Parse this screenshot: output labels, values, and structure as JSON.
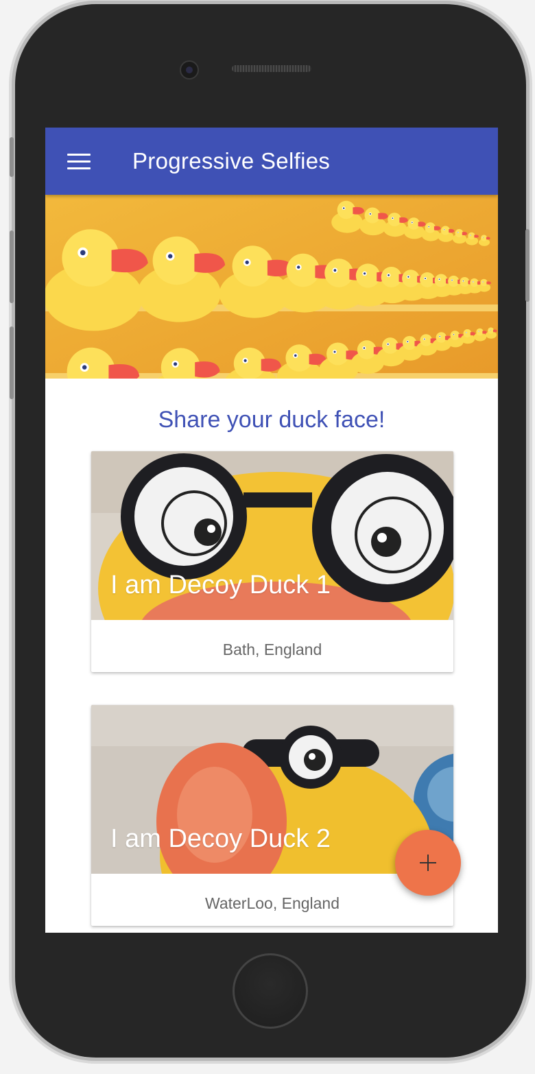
{
  "app": {
    "title": "Progressive Selfies"
  },
  "icons": {
    "menu": "hamburger-menu-icon",
    "fab": "plus-icon"
  },
  "colors": {
    "appbar": "#3f51b5",
    "headline": "#3f51b5",
    "fab": "#ee744a",
    "location_text": "#666666"
  },
  "main": {
    "headline": "Share your duck face!"
  },
  "cards": [
    {
      "title": "I am Decoy Duck 1",
      "location": "Bath, England"
    },
    {
      "title": "I am Decoy Duck 2",
      "location": "WaterLoo, England"
    }
  ]
}
